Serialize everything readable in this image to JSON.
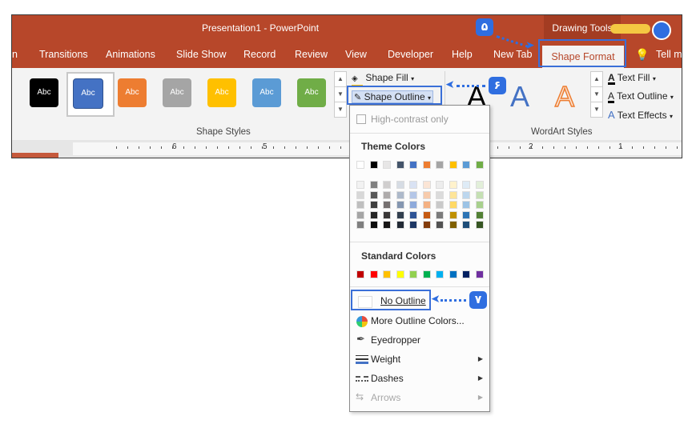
{
  "window": {
    "title": "Presentation1  -  PowerPoint",
    "contextual_tab_group": "Drawing Tools"
  },
  "tabs": [
    {
      "label": "n"
    },
    {
      "label": "Transitions"
    },
    {
      "label": "Animations"
    },
    {
      "label": "Slide Show"
    },
    {
      "label": "Record"
    },
    {
      "label": "Review"
    },
    {
      "label": "View"
    },
    {
      "label": "Developer"
    },
    {
      "label": "Help"
    },
    {
      "label": "New Tab"
    },
    {
      "label": "Shape Format"
    },
    {
      "label": "Tell m"
    }
  ],
  "shape_styles": {
    "group_label": "Shape Styles",
    "presets": [
      {
        "label": "Abc",
        "color": "#000000"
      },
      {
        "label": "Abc",
        "color": "#4472c4"
      },
      {
        "label": "Abc",
        "color": "#ed7d31"
      },
      {
        "label": "Abc",
        "color": "#a5a5a5"
      },
      {
        "label": "Abc",
        "color": "#ffc000"
      },
      {
        "label": "Abc",
        "color": "#5b9bd5"
      },
      {
        "label": "Abc",
        "color": "#70ad47"
      }
    ],
    "shape_fill_label": "Shape Fill",
    "shape_outline_label": "Shape Outline"
  },
  "wordart_styles": {
    "group_label": "WordArt Styles",
    "samples": [
      "A",
      "A",
      "A"
    ],
    "text_fill_label": "Text Fill",
    "text_outline_label": "Text Outline",
    "text_effects_label": "Text Effects"
  },
  "ruler": {
    "numbers": [
      "6",
      "5",
      "2",
      "1"
    ]
  },
  "outline_menu": {
    "high_contrast_label": "High-contrast only",
    "theme_colors_title": "Theme Colors",
    "theme_colors": [
      "#ffffff",
      "#000000",
      "#e7e6e6",
      "#44546a",
      "#4472c4",
      "#ed7d31",
      "#a5a5a5",
      "#ffc000",
      "#5b9bd5",
      "#70ad47"
    ],
    "theme_shades": [
      [
        "#f2f2f2",
        "#808080",
        "#d0cece",
        "#d6dce4",
        "#d9e2f3",
        "#fbe5d5",
        "#ededed",
        "#fff2cc",
        "#deebf6",
        "#e2efd9"
      ],
      [
        "#d8d8d8",
        "#595959",
        "#aeabab",
        "#adb9ca",
        "#b4c6e7",
        "#f7cbac",
        "#dbdbdb",
        "#fee599",
        "#bdd7ee",
        "#c5e0b3"
      ],
      [
        "#bfbfbf",
        "#3f3f3f",
        "#757070",
        "#8496b0",
        "#8eaadb",
        "#f4b183",
        "#c9c9c9",
        "#ffd965",
        "#9cc3e5",
        "#a8d08d"
      ],
      [
        "#a5a5a5",
        "#262626",
        "#3a3838",
        "#323f4f",
        "#2f5496",
        "#c55a11",
        "#7b7b7b",
        "#bf9000",
        "#2e75b5",
        "#538135"
      ],
      [
        "#7f7f7f",
        "#0c0c0c",
        "#171616",
        "#222a35",
        "#1e3864",
        "#833c0b",
        "#525252",
        "#7f6000",
        "#1e4e79",
        "#375623"
      ]
    ],
    "standard_colors_title": "Standard Colors",
    "standard_colors": [
      "#c00000",
      "#ff0000",
      "#ffc000",
      "#ffff00",
      "#92d050",
      "#00b050",
      "#00b0f0",
      "#0070c0",
      "#002060",
      "#7030a0"
    ],
    "no_outline_label": "No Outline",
    "more_colors_label": "More Outline Colors...",
    "eyedropper_label": "Eyedropper",
    "weight_label": "Weight",
    "dashes_label": "Dashes",
    "arrows_label": "Arrows"
  },
  "annotations": {
    "step5": "۵",
    "step6": "۶",
    "step7": "۷",
    "highlight_color": "#3a6fd8"
  }
}
